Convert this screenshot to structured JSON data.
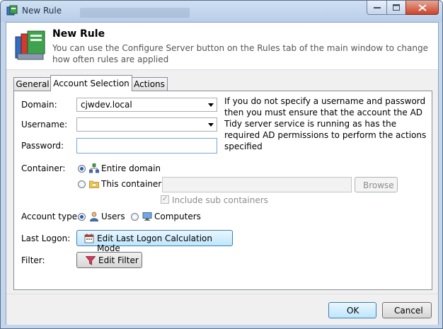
{
  "window": {
    "title": "New Rule"
  },
  "header": {
    "title": "New Rule",
    "description": "You can use the Configure Server button on the Rules tab of the main window to change how often rules are applied"
  },
  "tabs": [
    {
      "label": "General",
      "active": false
    },
    {
      "label": "Account Selection",
      "active": true
    },
    {
      "label": "Actions",
      "active": false
    }
  ],
  "form": {
    "domain_label": "Domain:",
    "domain_value": "cjwdev.local",
    "username_label": "Username:",
    "username_value": "",
    "password_label": "Password:",
    "password_value": "",
    "info_text": "If you do not specify a username and password then you must ensure that the account the AD Tidy server service is running as has the required AD permissions to perform the actions specified",
    "container_label": "Container:",
    "entire_domain_label": "Entire domain",
    "this_container_label": "This container:",
    "container_value": "",
    "browse_label": "Browse",
    "include_sub_label": "Include sub containers",
    "account_type_label": "Account type:",
    "users_label": "Users",
    "computers_label": "Computers",
    "last_logon_label": "Last Logon:",
    "edit_last_logon_label": "Edit Last Logon Calculation Mode",
    "filter_label": "Filter:",
    "edit_filter_label": "Edit Filter"
  },
  "footer": {
    "ok_label": "OK",
    "cancel_label": "Cancel"
  },
  "colors": {
    "titlebar": "#c4d6ec",
    "close_button": "#c9462c",
    "radio_dot": "#2a5ca8",
    "blue_button": "#bee6fd"
  }
}
